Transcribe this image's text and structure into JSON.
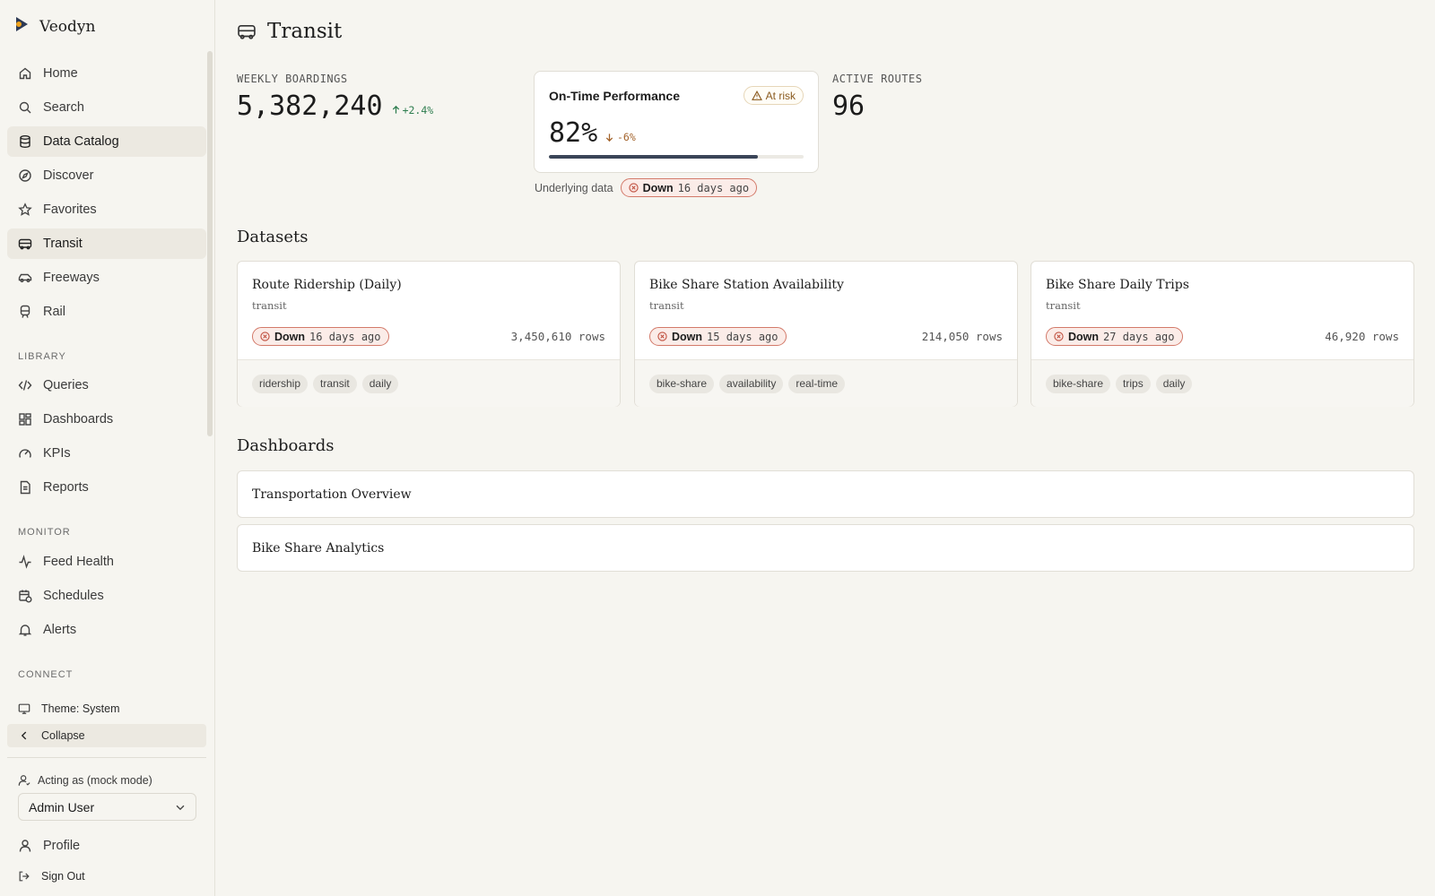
{
  "app": {
    "name": "Veodyn"
  },
  "sidebar": {
    "nav": [
      {
        "label": "Home",
        "icon": "home-icon"
      },
      {
        "label": "Search",
        "icon": "search-icon"
      },
      {
        "label": "Data Catalog",
        "icon": "database-icon",
        "active": true
      },
      {
        "label": "Discover",
        "icon": "compass-icon"
      },
      {
        "label": "Favorites",
        "icon": "star-icon"
      },
      {
        "label": "Transit",
        "icon": "bus-icon",
        "active": true
      },
      {
        "label": "Freeways",
        "icon": "car-icon"
      },
      {
        "label": "Rail",
        "icon": "train-icon"
      }
    ],
    "library_label": "LIBRARY",
    "library": [
      {
        "label": "Queries",
        "icon": "code-icon"
      },
      {
        "label": "Dashboards",
        "icon": "grid-icon"
      },
      {
        "label": "KPIs",
        "icon": "gauge-icon"
      },
      {
        "label": "Reports",
        "icon": "document-icon"
      }
    ],
    "monitor_label": "MONITOR",
    "monitor": [
      {
        "label": "Feed Health",
        "icon": "activity-icon"
      },
      {
        "label": "Schedules",
        "icon": "calendar-clock-icon"
      },
      {
        "label": "Alerts",
        "icon": "bell-icon"
      }
    ],
    "connect_label": "CONNECT",
    "theme_label": "Theme: System",
    "collapse_label": "Collapse",
    "acting_label": "Acting as (mock mode)",
    "acting_value": "Admin User",
    "profile_label": "Profile",
    "signout_label": "Sign Out"
  },
  "page": {
    "title": "Transit",
    "kpis": {
      "boardings": {
        "label": "WEEKLY BOARDINGS",
        "value": "5,382,240",
        "delta": "+2.4%"
      },
      "otp": {
        "title": "On-Time Performance",
        "badge": "At risk",
        "value": "82%",
        "delta": "-6%",
        "progress_percent": 82,
        "underlying_label": "Underlying data",
        "status_word": "Down",
        "status_rel": "16 days ago"
      },
      "routes": {
        "label": "ACTIVE ROUTES",
        "value": "96"
      }
    },
    "datasets_title": "Datasets",
    "datasets": [
      {
        "name": "Route Ridership (Daily)",
        "domain": "transit",
        "status_word": "Down",
        "status_rel": "16 days ago",
        "rows": "3,450,610 rows",
        "tags": [
          "ridership",
          "transit",
          "daily"
        ]
      },
      {
        "name": "Bike Share Station Availability",
        "domain": "transit",
        "status_word": "Down",
        "status_rel": "15 days ago",
        "rows": "214,050 rows",
        "tags": [
          "bike-share",
          "availability",
          "real-time"
        ]
      },
      {
        "name": "Bike Share Daily Trips",
        "domain": "transit",
        "status_word": "Down",
        "status_rel": "27 days ago",
        "rows": "46,920 rows",
        "tags": [
          "bike-share",
          "trips",
          "daily"
        ]
      }
    ],
    "dashboards_title": "Dashboards",
    "dashboards": [
      {
        "name": "Transportation Overview"
      },
      {
        "name": "Bike Share Analytics"
      }
    ]
  },
  "colors": {
    "background": "#f6f5f0",
    "active_nav": "#ece9e1",
    "positive": "#2e7d4f",
    "warning": "#a3632b",
    "down_border": "#d37a6a",
    "brand_accent": "#f0a31c"
  }
}
